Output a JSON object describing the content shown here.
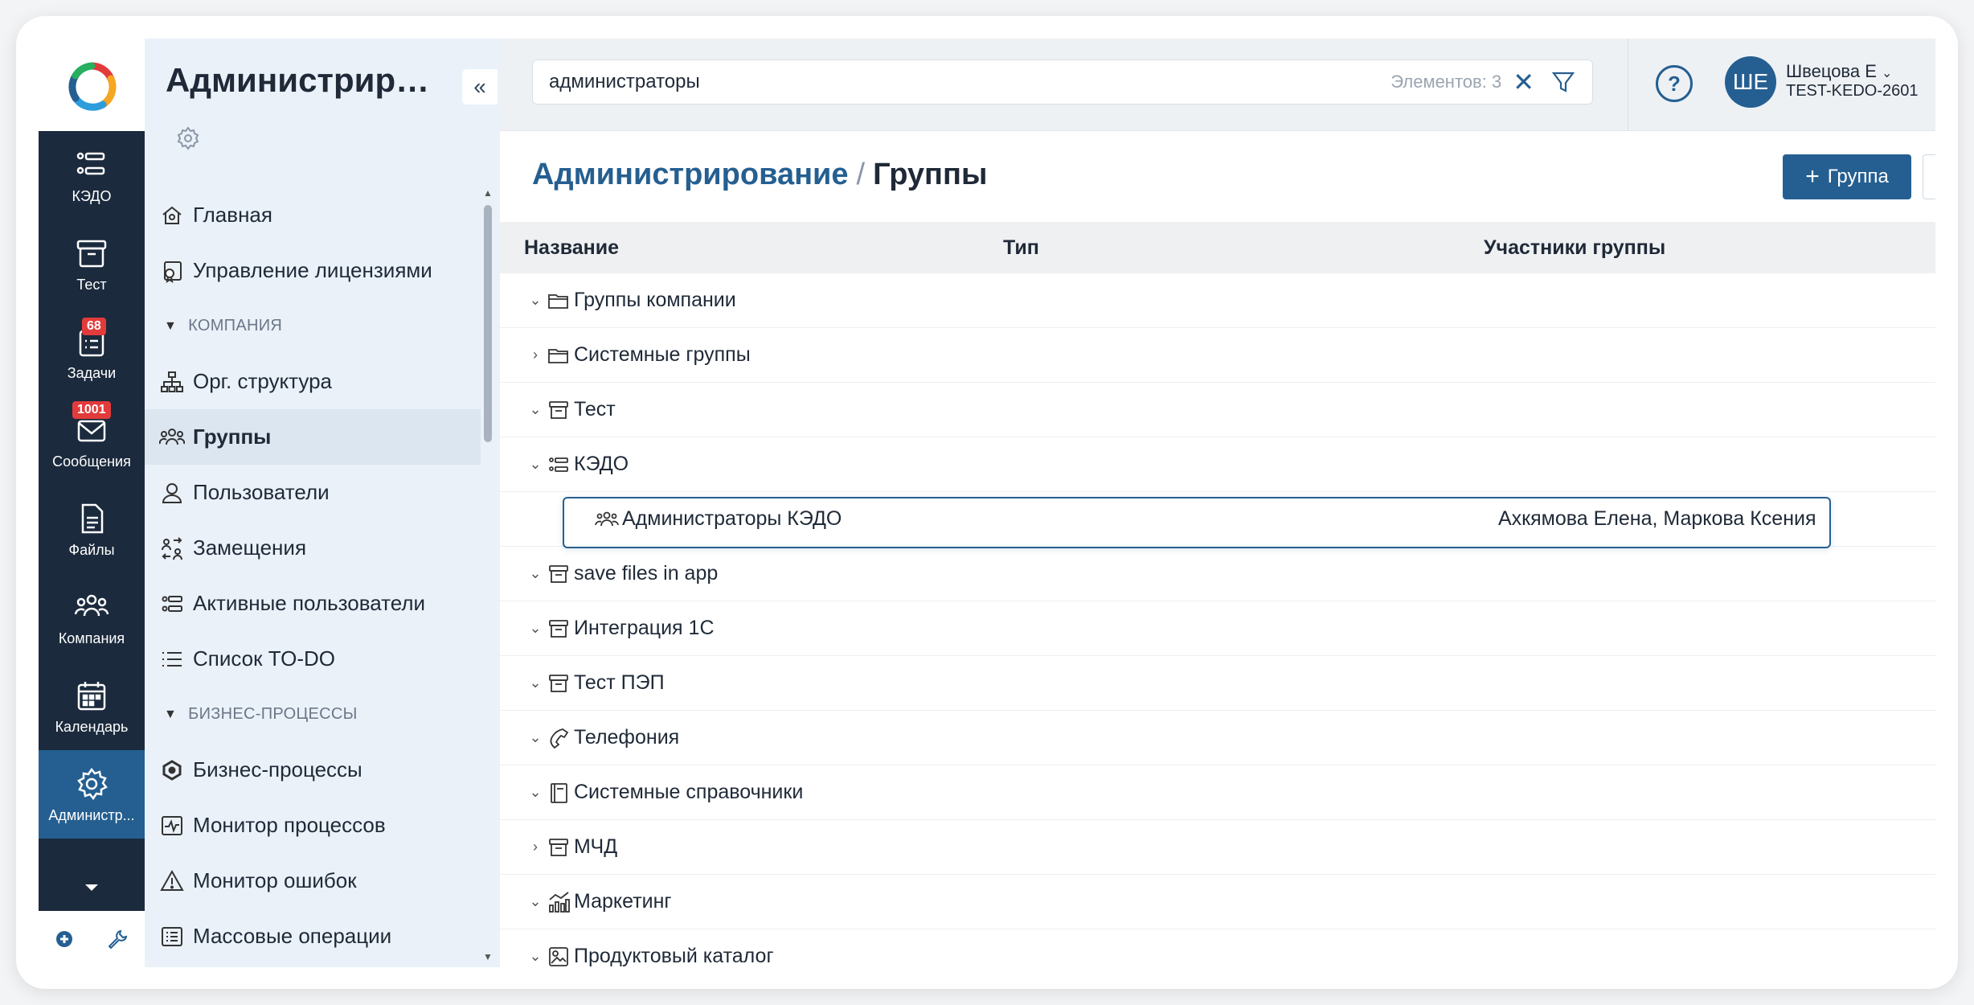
{
  "rail": {
    "items": [
      {
        "label": "КЭДО",
        "icon": "kedo-icon"
      },
      {
        "label": "Тест",
        "icon": "archive-box-icon"
      },
      {
        "label": "Задачи",
        "icon": "tasks-icon",
        "badge": "68"
      },
      {
        "label": "Сообщения",
        "icon": "mail-icon",
        "badge": "1001"
      },
      {
        "label": "Файлы",
        "icon": "file-icon"
      },
      {
        "label": "Компания",
        "icon": "people-icon"
      },
      {
        "label": "Календарь",
        "icon": "calendar-icon"
      },
      {
        "label": "Администр...",
        "icon": "gear-icon",
        "active": true
      }
    ],
    "colors": {
      "bg": "#1b2a3d",
      "active": "#255f91",
      "badge": "#e23b3b"
    }
  },
  "sidebar": {
    "title": "Администриров...",
    "collapse_label": "«",
    "items": [
      {
        "type": "item",
        "label": "Главная",
        "icon": "home-icon"
      },
      {
        "type": "item",
        "label": "Управление лицензиями",
        "icon": "license-icon"
      },
      {
        "type": "section",
        "label": "КОМПАНИЯ"
      },
      {
        "type": "item",
        "label": "Орг. структура",
        "icon": "org-chart-icon"
      },
      {
        "type": "item",
        "label": "Группы",
        "icon": "groups-icon",
        "active": true
      },
      {
        "type": "item",
        "label": "Пользователи",
        "icon": "user-icon"
      },
      {
        "type": "item",
        "label": "Замещения",
        "icon": "replacement-icon"
      },
      {
        "type": "item",
        "label": "Активные пользователи",
        "icon": "active-users-icon"
      },
      {
        "type": "item",
        "label": "Список TO-DO",
        "icon": "list-icon"
      },
      {
        "type": "section",
        "label": "БИЗНЕС-ПРОЦЕССЫ"
      },
      {
        "type": "item",
        "label": "Бизнес-процессы",
        "icon": "process-icon"
      },
      {
        "type": "item",
        "label": "Монитор процессов",
        "icon": "monitor-icon"
      },
      {
        "type": "item",
        "label": "Монитор ошибок",
        "icon": "warning-icon"
      },
      {
        "type": "item",
        "label": "Массовые операции",
        "icon": "bulk-icon"
      }
    ]
  },
  "topbar": {
    "search_value": "администраторы",
    "count_text": "Элементов: 3",
    "clear_label": "✕",
    "help_label": "?",
    "user": {
      "initials": "ШЕ",
      "name": "Швецова Е",
      "org": "TEST-KEDO-2601"
    }
  },
  "page": {
    "breadcrumb": "Администрирование",
    "separator": "/",
    "title": "Группы",
    "add_button": "Группа",
    "help_button": "?"
  },
  "table": {
    "columns": [
      "Название",
      "Тип",
      "Участники группы"
    ],
    "rows": [
      {
        "expand": "⌄",
        "icon": "folder-icon",
        "name": "Группы компании"
      },
      {
        "expand": "›",
        "icon": "folder-icon",
        "name": "Системные группы"
      },
      {
        "expand": "⌄",
        "icon": "archive-box-icon",
        "name": "Тест"
      },
      {
        "expand": "⌄",
        "icon": "kedo-icon",
        "name": "КЭДО"
      },
      {
        "expand": "",
        "icon": "groups-icon",
        "name": "Администраторы КЭДО",
        "members": "Ахкямова Елена, Маркова Ксения",
        "selected": true
      },
      {
        "expand": "⌄",
        "icon": "archive-box-icon",
        "name": "save files in app"
      },
      {
        "expand": "⌄",
        "icon": "archive-box-icon",
        "name": "Интеграция 1С"
      },
      {
        "expand": "⌄",
        "icon": "archive-box-icon",
        "name": "Тест ПЭП"
      },
      {
        "expand": "⌄",
        "icon": "phone-icon",
        "name": "Телефония"
      },
      {
        "expand": "⌄",
        "icon": "book-icon",
        "name": "Системные справочники"
      },
      {
        "expand": "›",
        "icon": "archive-box-icon",
        "name": "МЧД"
      },
      {
        "expand": "⌄",
        "icon": "chart-icon",
        "name": "Маркетинг"
      },
      {
        "expand": "⌄",
        "icon": "catalog-icon",
        "name": "Продуктовый каталог"
      }
    ]
  }
}
